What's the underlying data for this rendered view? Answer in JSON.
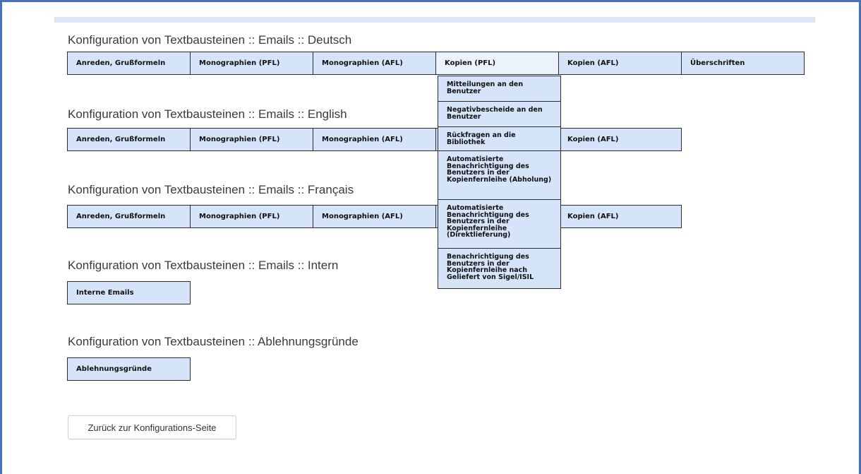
{
  "sections": {
    "deutsch": {
      "heading": "Konfiguration von Textbausteinen :: Emails :: Deutsch",
      "tabs": [
        "Anreden, Grußformeln",
        "Monographien (PFL)",
        "Monographien (AFL)",
        "Kopien (PFL)",
        "Kopien (AFL)",
        "Überschriften"
      ]
    },
    "english": {
      "heading": "Konfiguration von Textbausteinen :: Emails :: English",
      "tabs": [
        "Anreden, Grußformeln",
        "Monographien (PFL)",
        "Monographien (AFL)",
        "Kopien (AFL)"
      ]
    },
    "francais": {
      "heading": "Konfiguration von Textbausteinen :: Emails :: Français",
      "tabs": [
        "Anreden, Grußformeln",
        "Monographien (PFL)",
        "Monographien (AFL)",
        "Kopien (AFL)"
      ]
    },
    "intern": {
      "heading": "Konfiguration von Textbausteinen :: Emails :: Intern",
      "tabs": [
        "Interne Emails"
      ]
    },
    "ablehnung": {
      "heading": "Konfiguration von Textbausteinen :: Ablehnungsgründe",
      "tabs": [
        "Ablehnungsgründe"
      ]
    }
  },
  "dropdown": {
    "items": [
      "Mitteilungen an den Benutzer",
      "Negativbescheide an den Benutzer",
      "Rückfragen an die Bibliothek",
      "Automatisierte Benachrichtigung des Benutzers in der Kopienfernleihe (Abholung)",
      "Automatisierte Benachrichtigung des Benutzers in der Kopienfernleihe (Direktlieferung)",
      "Benachrichtigung des Benutzers in der Kopienfernleihe nach Geliefert von Sigel/ISIL"
    ]
  },
  "footer": {
    "back_label": "Zurück zur Konfigurations-Seite"
  }
}
